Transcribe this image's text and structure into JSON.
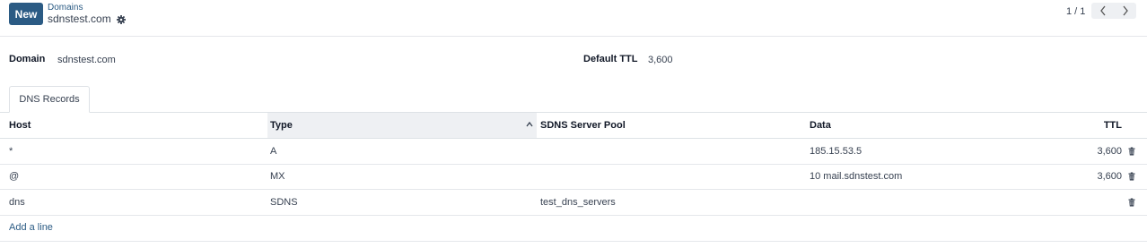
{
  "toolbar": {
    "new_label": "New",
    "breadcrumb_parent": "Domains",
    "breadcrumb_current": "sdnstest.com",
    "pager_value": "1 / 1"
  },
  "form": {
    "domain_label": "Domain",
    "domain_value": "sdnstest.com",
    "ttl_label": "Default TTL",
    "ttl_value": "3,600"
  },
  "tabs": [
    {
      "label": "DNS Records",
      "active": true
    }
  ],
  "table": {
    "headers": {
      "host": "Host",
      "type": "Type",
      "pool": "SDNS Server Pool",
      "data": "Data",
      "ttl": "TTL"
    },
    "sorted_by": "Type",
    "rows": [
      {
        "host": "*",
        "type": "A",
        "pool": "",
        "data": "185.15.53.5",
        "ttl": "3,600"
      },
      {
        "host": "@",
        "type": "MX",
        "pool": "",
        "data": "10 mail.sdnstest.com",
        "ttl": "3,600"
      },
      {
        "host": "dns",
        "type": "SDNS",
        "pool": "test_dns_servers",
        "data": "",
        "ttl": ""
      }
    ],
    "add_line_label": "Add a line"
  },
  "icons": {
    "settings": "gear-icon",
    "pager_prev": "chevron-left-icon",
    "pager_next": "chevron-right-icon",
    "sort": "chevron-up-icon",
    "delete": "trash-icon"
  },
  "colors": {
    "primary": "#2b5b84",
    "header_sorted_bg": "#eef0f3",
    "border": "#dee2e6"
  }
}
